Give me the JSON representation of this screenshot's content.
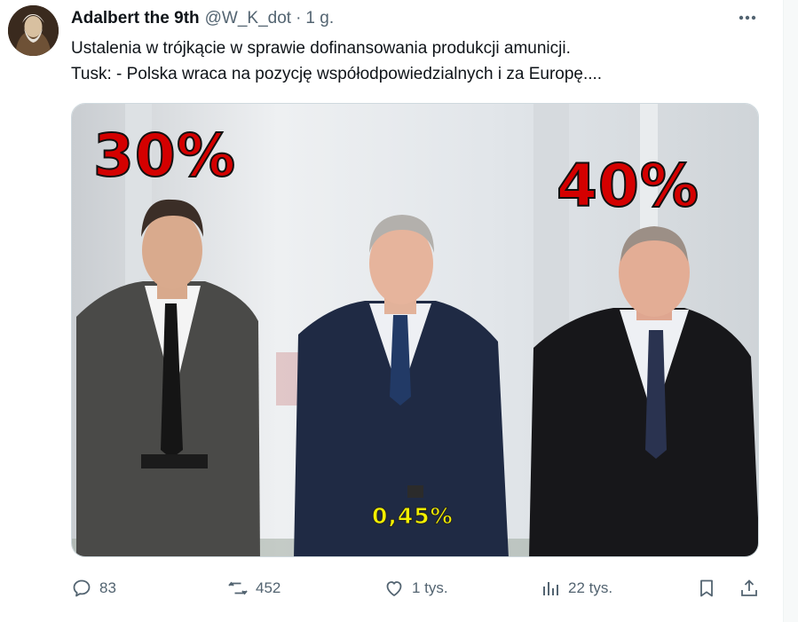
{
  "author": {
    "name": "Adalbert the 9th",
    "handle": "@W_K_dot",
    "separator": "·",
    "time": "1 g."
  },
  "tweet": {
    "line1": "Ustalenia w trójkącie w sprawie dofinansowania produkcji amunicji.",
    "line2": "Tusk: - Polska wraca na pozycję współodpowiedzialnych i za Europę...."
  },
  "image": {
    "label_left": "30%",
    "label_right": "40%",
    "label_middle": "0,45%"
  },
  "actions": {
    "replies": "83",
    "reposts": "452",
    "likes": "1 tys.",
    "views": "22 tys."
  },
  "icons": [
    "more-icon",
    "reply-icon",
    "repost-icon",
    "like-icon",
    "views-icon",
    "bookmark-icon",
    "share-icon"
  ]
}
